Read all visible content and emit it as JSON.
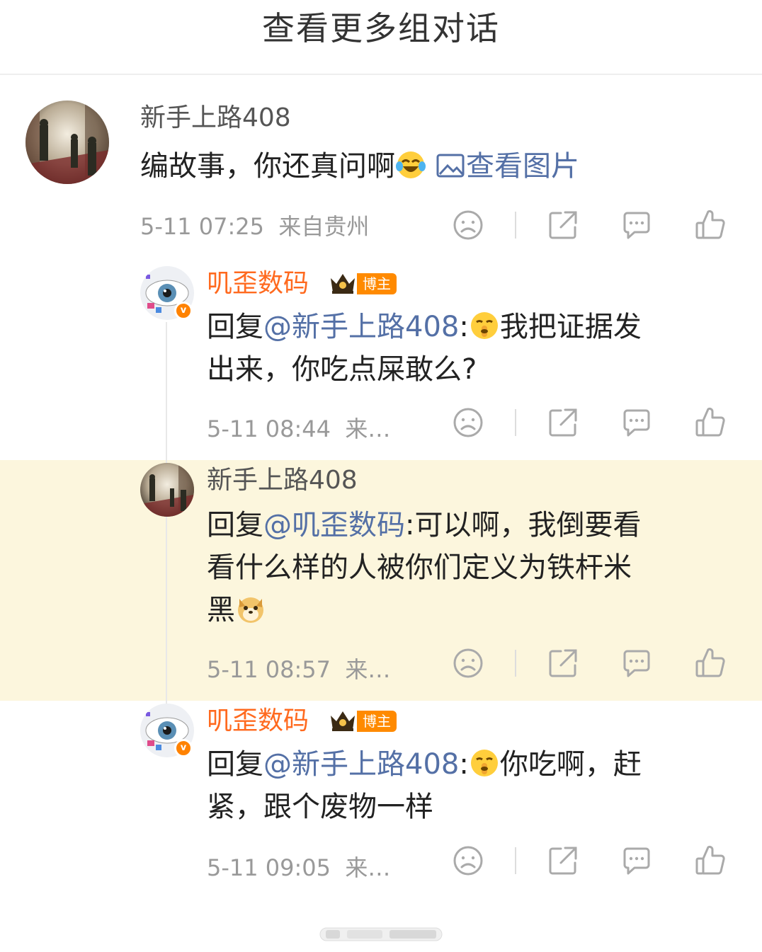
{
  "header": {
    "title": "查看更多组对话"
  },
  "comments": [
    {
      "user": "新手上路408",
      "text_before": "编故事，你还真问啊",
      "link_text": "查看图片",
      "time": "5-11 07:25",
      "source": "来自贵州",
      "emoji": "laugh-cry-icon",
      "avatar": "guards-photo-avatar"
    },
    {
      "user": "叽歪数码",
      "badge": "博主",
      "reply_prefix": "回复",
      "mention": "@新手上路408",
      "colon": ":",
      "text": "我把证据发",
      "text_line2": "出来，你吃点屎敢么?",
      "time": "5-11 08:44",
      "source": "来…",
      "emoji": "shush-icon"
    },
    {
      "user": "新手上路408",
      "reply_prefix": "回复",
      "mention": "@叽歪数码",
      "colon": ":",
      "text": "可以啊，我倒要看",
      "text_line2": "看什么样的人被你们定义为铁杆米",
      "text_line3": "黑",
      "time": "5-11 08:57",
      "source": "来…",
      "emoji": "doge-icon"
    },
    {
      "user": "叽歪数码",
      "badge": "博主",
      "reply_prefix": "回复",
      "mention": "@新手上路408",
      "colon": ":",
      "text": "你吃啊，赶",
      "text_line2": "紧，跟个废物一样",
      "time": "5-11 09:05",
      "source": "来…",
      "emoji": "shush-icon"
    }
  ],
  "colors": {
    "accent_orange": "#ff6a1f",
    "mention_blue": "#5470a6",
    "highlight_bg": "#fcf6dd",
    "badge_orange": "#ff8a00"
  },
  "actions": [
    "sad-face-icon",
    "share-icon",
    "comment-icon",
    "like-icon"
  ]
}
